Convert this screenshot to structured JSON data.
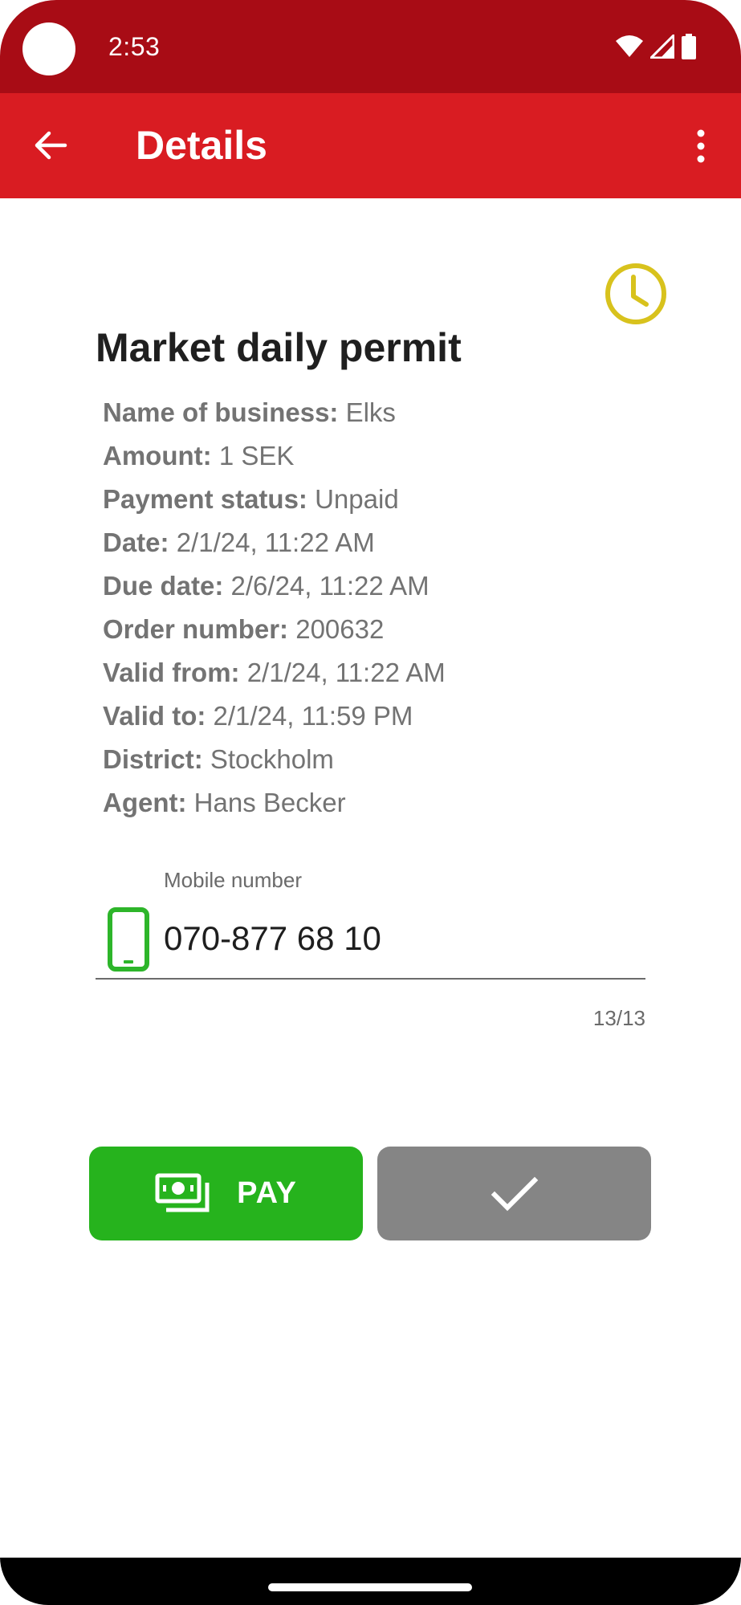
{
  "status_bar": {
    "time": "2:53",
    "icons": [
      "wifi-icon",
      "signal-icon",
      "battery-icon"
    ]
  },
  "app_bar": {
    "title": "Details",
    "back_icon": "arrow-back-icon",
    "menu_icon": "more-vert-icon",
    "background": "#d91c22"
  },
  "permit": {
    "status_icon": "clock-icon",
    "status_icon_color": "#d8c21d",
    "title": "Market daily permit",
    "details": [
      {
        "label": "Name of business:",
        "value": "Elks"
      },
      {
        "label": "Amount:",
        "value": "1 SEK"
      },
      {
        "label": "Payment status:",
        "value": "Unpaid"
      },
      {
        "label": "Date:",
        "value": "2/1/24, 11:22 AM"
      },
      {
        "label": "Due date:",
        "value": "2/6/24, 11:22 AM"
      },
      {
        "label": "Order number:",
        "value": "200632"
      },
      {
        "label": "Valid from:",
        "value": "2/1/24, 11:22 AM"
      },
      {
        "label": "Valid to:",
        "value": "2/1/24, 11:59 PM"
      },
      {
        "label": "District:",
        "value": "Stockholm"
      },
      {
        "label": "Agent:",
        "value": "Hans Becker"
      }
    ]
  },
  "mobile_field": {
    "label": "Mobile number",
    "value": "070-877 68 10",
    "counter": "13/13",
    "icon": "smartphone-icon",
    "icon_color": "#2db52a"
  },
  "actions": {
    "pay_label": "PAY",
    "pay_icon": "payments-icon",
    "pay_color": "#26b31d",
    "confirm_icon": "check-icon",
    "confirm_color": "#858585"
  }
}
